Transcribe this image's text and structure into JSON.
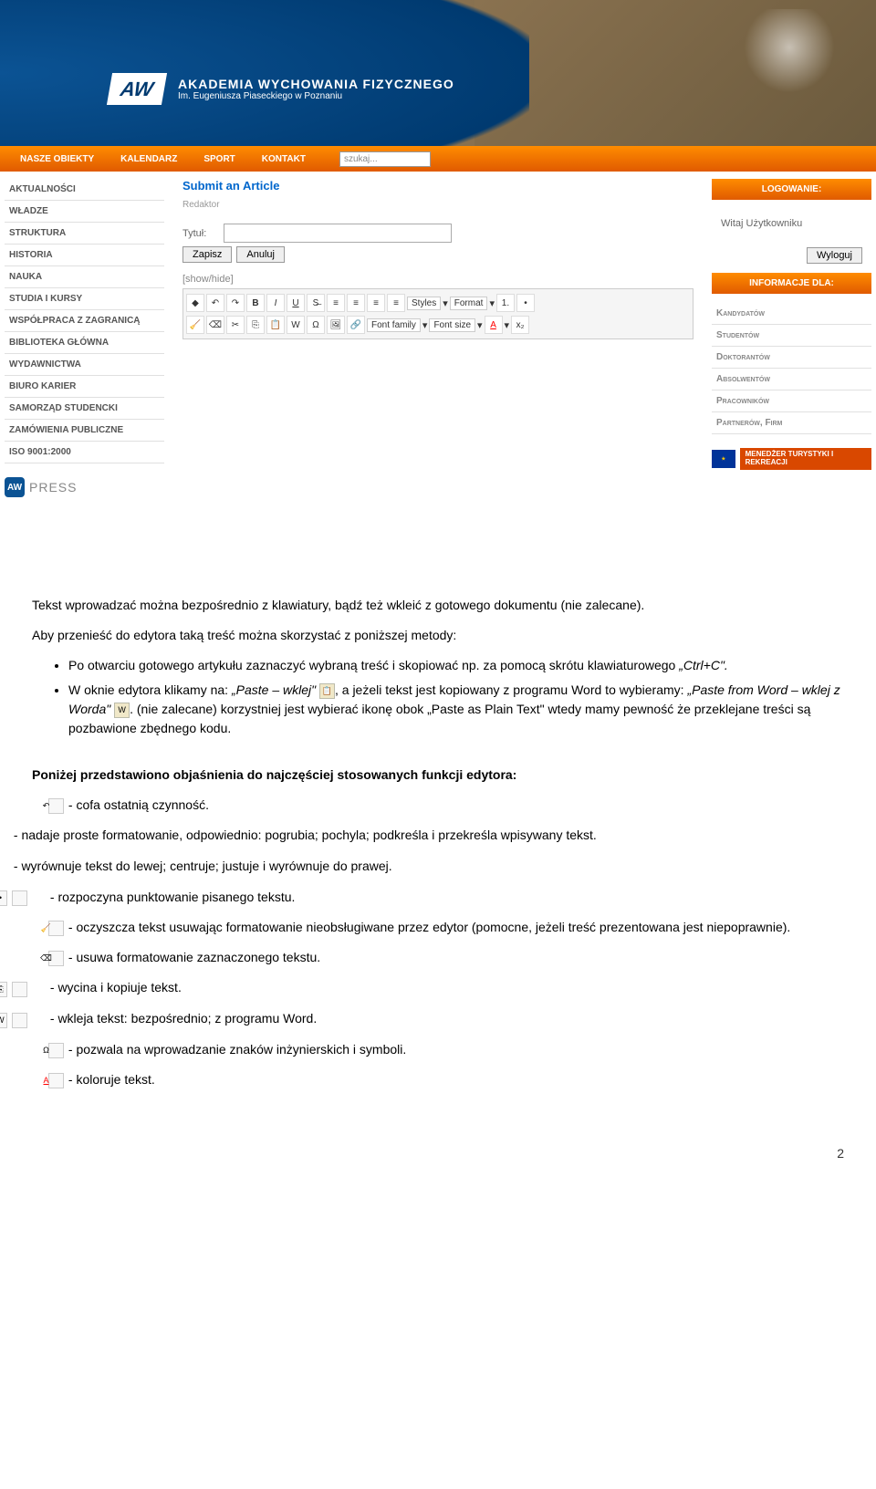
{
  "banner": {
    "logo_mark": "AW",
    "line1": "AKADEMIA WYCHOWANIA FIZYCZNEGO",
    "line2": "Im. Eugeniusza Piaseckiego w Poznaniu"
  },
  "nav": {
    "items": [
      "NASZE OBIEKTY",
      "KALENDARZ",
      "SPORT",
      "KONTAKT"
    ],
    "search_placeholder": "szukaj..."
  },
  "left_nav": [
    "Aktualności",
    "Władze",
    "Struktura",
    "Historia",
    "Nauka",
    "Studia i kursy",
    "Współpraca z zagranicą",
    "Biblioteka Główna",
    "Wydawnictwa",
    "Biuro Karier",
    "Samorząd Studencki",
    "Zamówienia publiczne",
    "ISO 9001:2000"
  ],
  "press_label": "PRESS",
  "editor": {
    "submit": "Submit an Article",
    "redaktor": "Redaktor",
    "title_label": "Tytuł:",
    "save": "Zapisz",
    "cancel": "Anuluj",
    "showhide": "[show/hide]",
    "styles": "Styles",
    "format": "Format",
    "font_family": "Font family",
    "font_size": "Font size"
  },
  "right": {
    "login_head": "LOGOWANIE:",
    "welcome": "Witaj Użytkowniku",
    "logout": "Wyloguj",
    "info_head": "INFORMACJE DLA:",
    "info_items": [
      "Kandydatów",
      "Studentów",
      "Doktorantów",
      "Absolwentów",
      "Pracowników",
      "Partnerów, Firm"
    ],
    "eu": "MENEDŻER\nTURYSTYKI\nI REKREACJI"
  },
  "doc": {
    "p1": "Tekst wprowadzać można bezpośrednio z klawiatury, bądź też wkleić z gotowego dokumentu (nie zalecane).",
    "p2": "Aby przenieść do edytora taką treść można skorzystać z poniższej metody:",
    "li1a": "Po otwarciu gotowego artykułu zaznaczyć wybraną treść i skopiować np. za pomocą skrótu klawiaturowego ",
    "li1b": "„Ctrl+C\".",
    "li2a": "W oknie edytora klikamy na: ",
    "li2b": "„Paste – wklej\"",
    "li2c": ", a jeżeli tekst jest kopiowany z programu Word to wybieramy: ",
    "li2d": "„Paste from Word – wklej z Worda\"",
    "li2e": ". (nie zalecane) korzystniej jest wybierać ikonę obok „Paste as Plain Text\" wtedy mamy pewność że przeklejane treści są pozbawione zbędnego kodu.",
    "p3": "Poniżej przedstawiono objaśnienia do najczęściej stosowanych funkcji edytora:",
    "f1": "- cofa ostatnią czynność.",
    "f2": "- nadaje proste formatowanie, odpowiednio: pogrubia; pochyla; podkreśla i przekreśla wpisywany tekst.",
    "f3": "- wyrównuje tekst do lewej; centruje; justuje i wyrównuje do prawej.",
    "f4": "- rozpoczyna punktowanie pisanego tekstu.",
    "f5": "- oczyszcza tekst usuwając formatowanie nieobsługiwane przez edytor (pomocne, jeżeli treść prezentowana jest niepoprawnie).",
    "f6": "- usuwa formatowanie zaznaczonego tekstu.",
    "f7": "- wycina i kopiuje tekst.",
    "f8": "- wkleja tekst: bezpośrednio; z programu Word.",
    "f9": "- pozwala na wprowadzanie znaków inżynierskich i symboli.",
    "f10": "- koloruje tekst.",
    "page": "2"
  }
}
